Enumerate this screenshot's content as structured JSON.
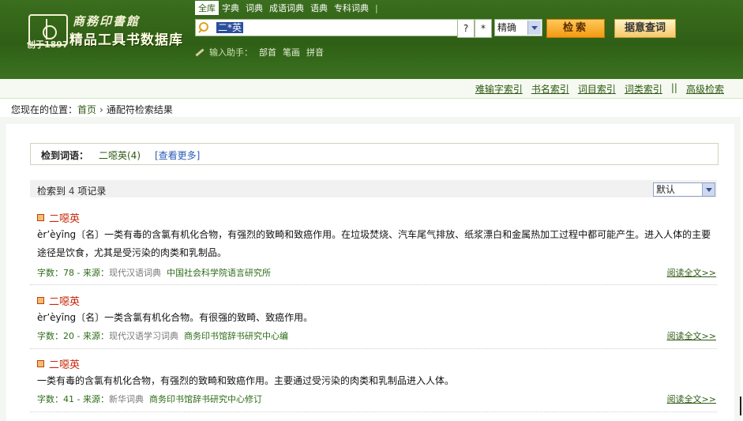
{
  "header": {
    "logo": {
      "publisher_name": "商務印書館",
      "db_name": "精品工具书数据库",
      "established": "创于1897"
    },
    "nav_tabs": [
      {
        "label": "全库",
        "active": true
      },
      {
        "label": "字典",
        "active": false
      },
      {
        "label": "词典",
        "active": false
      },
      {
        "label": "成语词典",
        "active": false
      },
      {
        "label": "语典",
        "active": false
      },
      {
        "label": "专科词典",
        "active": false
      }
    ],
    "nav_separator": "|",
    "search": {
      "value": "二*英",
      "wildcard_single": "?",
      "wildcard_multi": "*",
      "mode_selected": "精确",
      "search_button": "检索",
      "reverse_button": "据意查词"
    },
    "input_helper": {
      "label": "输入助手：",
      "options": [
        "部首",
        "笔画",
        "拼音"
      ]
    }
  },
  "index_bar": {
    "links": [
      "难输字索引",
      "书名索引",
      "词目索引",
      "词类索引"
    ],
    "separator": "||",
    "advanced": "高级检索"
  },
  "breadcrumb": {
    "prefix": "您现在的位置：",
    "home": "首页",
    "chevron": "›",
    "current": "通配符检索结果"
  },
  "found_terms": {
    "label": "检到词语：",
    "term": "二噁英(4)",
    "more": "[查看更多]"
  },
  "results_header": {
    "prefix": "检索到",
    "count": "4",
    "suffix": "项记录",
    "sort_selected": "默认"
  },
  "results": [
    {
      "headword": "二噁英",
      "body": "èr’èyīng〔名〕一类有毒的含氯有机化合物，有强烈的致畸和致癌作用。在垃圾焚烧、汽车尾气排放、纸浆漂白和金属热加工过程中都可能产生。进入人体的主要途径是饮食，尤其是受污染的肉类和乳制品。",
      "meta_prefix": "字数：78 - 来源：",
      "source": "现代汉语词典",
      "publisher": "中国社会科学院语言研究所",
      "read_more": "阅读全文>>"
    },
    {
      "headword": "二噁英",
      "body": "èr’èyīng〔名〕一类含氯有机化合物。有很强的致畸、致癌作用。",
      "meta_prefix": "字数：20 - 来源：",
      "source": "现代汉语学习词典",
      "publisher": "商务印书馆辞书研究中心编",
      "read_more": "阅读全文>>"
    },
    {
      "headword": "二噁英",
      "body": "一类有毒的含氯有机化合物，有强烈的致畸和致癌作用。主要通过受污染的肉类和乳制品进入人体。",
      "meta_prefix": "字数：41 - 来源：",
      "source": "新华词典",
      "publisher": "商务印书馆辞书研究中心修订",
      "read_more": "阅读全文>>"
    }
  ],
  "colors": {
    "header_green": "#2f5f16",
    "headword_red": "#c8280a",
    "link_green": "#2d5a13",
    "search_orange": "#f29a12"
  }
}
